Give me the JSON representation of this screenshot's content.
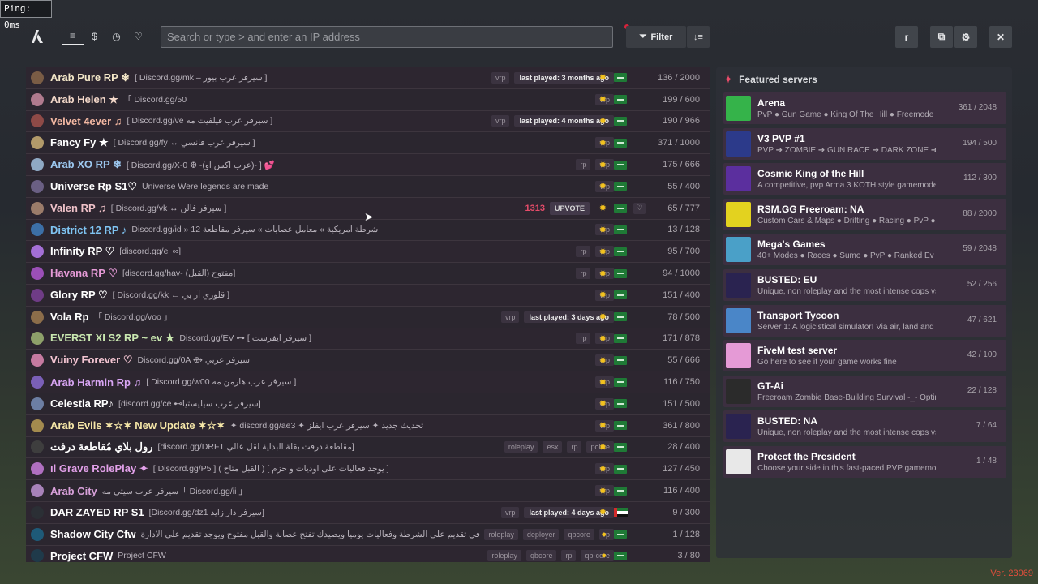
{
  "ping": "Ping: 0ms",
  "search_placeholder": "Search or type > and enter an IP address",
  "filter_label": "Filter",
  "profile_initial": "r",
  "featured_title": "Featured servers",
  "version": "Ver. 23069",
  "colors": {
    "accent": "#e84c6a",
    "version": "#e64e3c",
    "flag_green": "#1f7a36",
    "sun": "#f3c21e"
  },
  "servers": [
    {
      "name": "Arab Pure RP ❄",
      "color": "#f4e7c8",
      "desc": "[ Discord.gg/mk – سيرفر عرب بيور ]",
      "tags": [
        "vrp"
      ],
      "last": "last played: 3 months ago",
      "count": "136 / 2000",
      "icon": "#7a5c45"
    },
    {
      "name": "Arab Helen ★",
      "color": "#f2d7c8",
      "desc": "「 Discord.gg/50",
      "tags": [
        "vrp"
      ],
      "last": "",
      "count": "199 / 600",
      "icon": "#b07a8e"
    },
    {
      "name": "Velvet 4ever ♫",
      "color": "#f2b7a2",
      "desc": "[ Discord.gg/ve سيرفر عرب فيلفيت مه ]",
      "tags": [
        "vrp"
      ],
      "last": "last played: 4 months ago",
      "count": "190 / 966",
      "icon": "#8e4a47"
    },
    {
      "name": "Fancy Fy ★",
      "color": "#ffffff",
      "desc": "[ Discord.gg/fy ↔ سيرفر عرب فانسي ]",
      "tags": [
        "vrp"
      ],
      "last": "",
      "count": "371 / 1000",
      "icon": "#b29a6a"
    },
    {
      "name": "Arab XO RP ❄",
      "color": "#9cc7ef",
      "desc": "[ Discord.gg/X-0 ❆ -(عرب اكس او)- ] 💕",
      "tags": [
        "rp",
        "vrp"
      ],
      "last": "",
      "count": "175 / 666",
      "icon": "#8fa9c4"
    },
    {
      "name": "Universe Rp S1♡",
      "color": "#ffffff",
      "desc": "Universe Were legends are made",
      "tags": [
        "vrp"
      ],
      "last": "",
      "count": "55 / 400",
      "icon": "#6a5f83"
    },
    {
      "name": "Valen RP ♫",
      "color": "#f0c2c9",
      "desc": "[ Discord.gg/vk ↔ سيرفر فالن ]",
      "tags": [],
      "last": "",
      "count": "65 / 777",
      "icon": "#9b7c6a",
      "boost": "1313",
      "upvote": "UPVOTE"
    },
    {
      "name": "District 12 RP ♪",
      "color": "#7fc4f2",
      "desc": "Discord.gg/id » شرطة أمريكية » معامل عصابات » سيرفر مقاطعة 12",
      "tags": [
        "vrp"
      ],
      "last": "",
      "count": "13 / 128",
      "icon": "#3c6fa6"
    },
    {
      "name": "Infinity RP ♡",
      "color": "#ffffff",
      "desc": "[discord.gg/ei ∞]",
      "tags": [
        "rp",
        "vrp"
      ],
      "last": "",
      "count": "95 / 700",
      "icon": "#a46fd6"
    },
    {
      "name": "Havana RP ♡",
      "color": "#e79bd8",
      "desc": "[discord.gg/hav- مفتوح (القبل)]",
      "tags": [
        "rp",
        "vrp"
      ],
      "last": "",
      "count": "94 / 1000",
      "icon": "#9b4fb7"
    },
    {
      "name": "Glory RP ♡",
      "color": "#ffffff",
      "desc": "[ Discord.gg/kk ← قلوري آر بي ]",
      "tags": [
        "vrp"
      ],
      "last": "",
      "count": "151 / 400",
      "icon": "#6f3c86"
    },
    {
      "name": "Vola Rp",
      "color": "#ffffff",
      "desc": "「 Discord.gg/voo 」",
      "tags": [
        "vrp"
      ],
      "last": "last played: 3 days ago",
      "count": "78 / 500",
      "icon": "#8c6d4a"
    },
    {
      "name": "EVERST XI S2 RP ~ ev ★",
      "color": "#c9e7b0",
      "desc": "Discord.gg/EV ⊶ [ سيرفر ايفرست ]",
      "tags": [
        "rp",
        "vrp"
      ],
      "last": "",
      "count": "171 / 878",
      "icon": "#8ea06a"
    },
    {
      "name": "Vuiny Forever ♡",
      "color": "#f2c4d1",
      "desc": "Discord.gg/0A ⟴ سيرفر عربي",
      "tags": [
        "vrp"
      ],
      "last": "",
      "count": "55 / 666",
      "icon": "#c57aa0"
    },
    {
      "name": "Arab Harmin Rp ♫",
      "color": "#d7a4f2",
      "desc": "[ Discord.gg/w00 سيرفر عرب هارمن مه ]",
      "tags": [
        "vrp"
      ],
      "last": "",
      "count": "116 / 750",
      "icon": "#7a5fb7"
    },
    {
      "name": "Celestia RP♪",
      "color": "#ffffff",
      "desc": "[discord.gg/ce ⊷سيرفر عرب سيليستيا]",
      "tags": [
        "vrp"
      ],
      "last": "",
      "count": "151 / 500",
      "icon": "#6c7ea3"
    },
    {
      "name": "Arab Evils ✶☆✶ New Update ✶☆✶",
      "color": "#f6e7a8",
      "desc": "✦ discord.gg/ae3 ✦ تحديث جديد ✦ سيرفر عرب ايفلز",
      "tags": [
        "vrp"
      ],
      "last": "",
      "count": "361 / 800",
      "icon": "#a38a4e"
    },
    {
      "name": "رول بلاي مُقاطعة درفت",
      "color": "#ffffff",
      "desc": "[discord.gg/DRFT مقاطعة درفت بقلة البداية لقل عالي]",
      "tags": [
        "roleplay",
        "esx",
        "rp",
        "police"
      ],
      "last": "",
      "count": "28 / 400",
      "icon": "#3e3e3e"
    },
    {
      "name": "ıl Grave RolePlay ✦",
      "color": "#e2a0e9",
      "desc": "[ Discord.gg/P5 ] ( القبل متاح ) [ يوجد فعاليات على اوديات و حزم ]",
      "tags": [
        "vrp"
      ],
      "last": "",
      "count": "127 / 450",
      "icon": "#b06fc0"
    },
    {
      "name": "Arab City",
      "color": "#d7a0d9",
      "desc": "سيرفر عرب سيتي مه「 Discord.gg/ii 」",
      "tags": [
        "vrp"
      ],
      "last": "",
      "count": "116 / 400",
      "icon": "#a782b9"
    },
    {
      "name": "DAR ZAYED RP S1",
      "color": "#ffffff",
      "desc": "[Discord.gg/dz1 سيرفر دار زايد]",
      "tags": [
        "vrp"
      ],
      "last": "last played: 4 days ago",
      "count": "9 / 300",
      "icon": "#2b2f35",
      "uae": true
    },
    {
      "name": "Shadow City Cfw",
      "color": "#ffffff",
      "desc": "حياكم الله في تقديم على الشرطة وفعاليات يومياً ويصيدك تفتح عصابة والقبل مفتوح ويوجد تقديم على الادارة",
      "tags": [
        "roleplay",
        "deployer",
        "qbcore",
        "rp"
      ],
      "last": "",
      "count": "1 / 128",
      "icon": "#1e5a78",
      "coin": true
    },
    {
      "name": "Project CFW",
      "color": "#ffffff",
      "desc": "Project CFW",
      "tags": [
        "roleplay",
        "qbcore",
        "rp",
        "qb-core"
      ],
      "last": "",
      "count": "3 / 80",
      "icon": "#1f3a4a",
      "coin": true
    }
  ],
  "featured": [
    {
      "title": "Arena",
      "desc": "PvP ● Gun Game ● King Of The Hill ● Freemode",
      "count": "361 / 2048",
      "icon": "#35b34a"
    },
    {
      "title": "V3 PVP #1",
      "desc": "PVP ➔ ZOMBIE ➔ GUN RACE ➔ DARK ZONE ➔ F",
      "count": "194 / 500",
      "icon": "#2c3a8a"
    },
    {
      "title": "Cosmic King of the Hill",
      "desc": "A competitive, pvp Arma 3 KOTH style gamemode",
      "count": "112 / 300",
      "icon": "#5b2f9e"
    },
    {
      "title": "RSM.GG Freeroam: NA",
      "desc": "Custom Cars & Maps ● Drifting ● Racing ● PvP ●",
      "count": "88 / 2000",
      "icon": "#e3d21f"
    },
    {
      "title": "Mega's Games",
      "desc": "40+ Modes ● Races ● Sumo ● PvP ● Ranked Ev",
      "count": "59 / 2048",
      "icon": "#4aa0c8"
    },
    {
      "title": "BUSTED: EU",
      "desc": "Unique, non roleplay and the most intense cops vs",
      "count": "52 / 256",
      "icon": "#2a2350"
    },
    {
      "title": "Transport Tycoon",
      "desc": "Server 1: A logicistical simulator! Via air, land and se",
      "count": "47 / 621",
      "icon": "#4a86c8"
    },
    {
      "title": "FiveM test server",
      "desc": "Go here to see if your game works fine",
      "count": "42 / 100",
      "icon": "#e59ad6"
    },
    {
      "title": "GT-Ai",
      "desc": "Freeroam Zombie Base-Building Survival -_- Optin",
      "count": "22 / 128",
      "icon": "#2b2b2b"
    },
    {
      "title": "BUSTED: NA",
      "desc": "Unique, non roleplay and the most intense cops vs n",
      "count": "7 / 64",
      "icon": "#2a2350"
    },
    {
      "title": "Protect the President",
      "desc": "Choose your side in this fast-paced PVP gamemode",
      "count": "1 / 48",
      "icon": "#e8e8e8"
    }
  ]
}
